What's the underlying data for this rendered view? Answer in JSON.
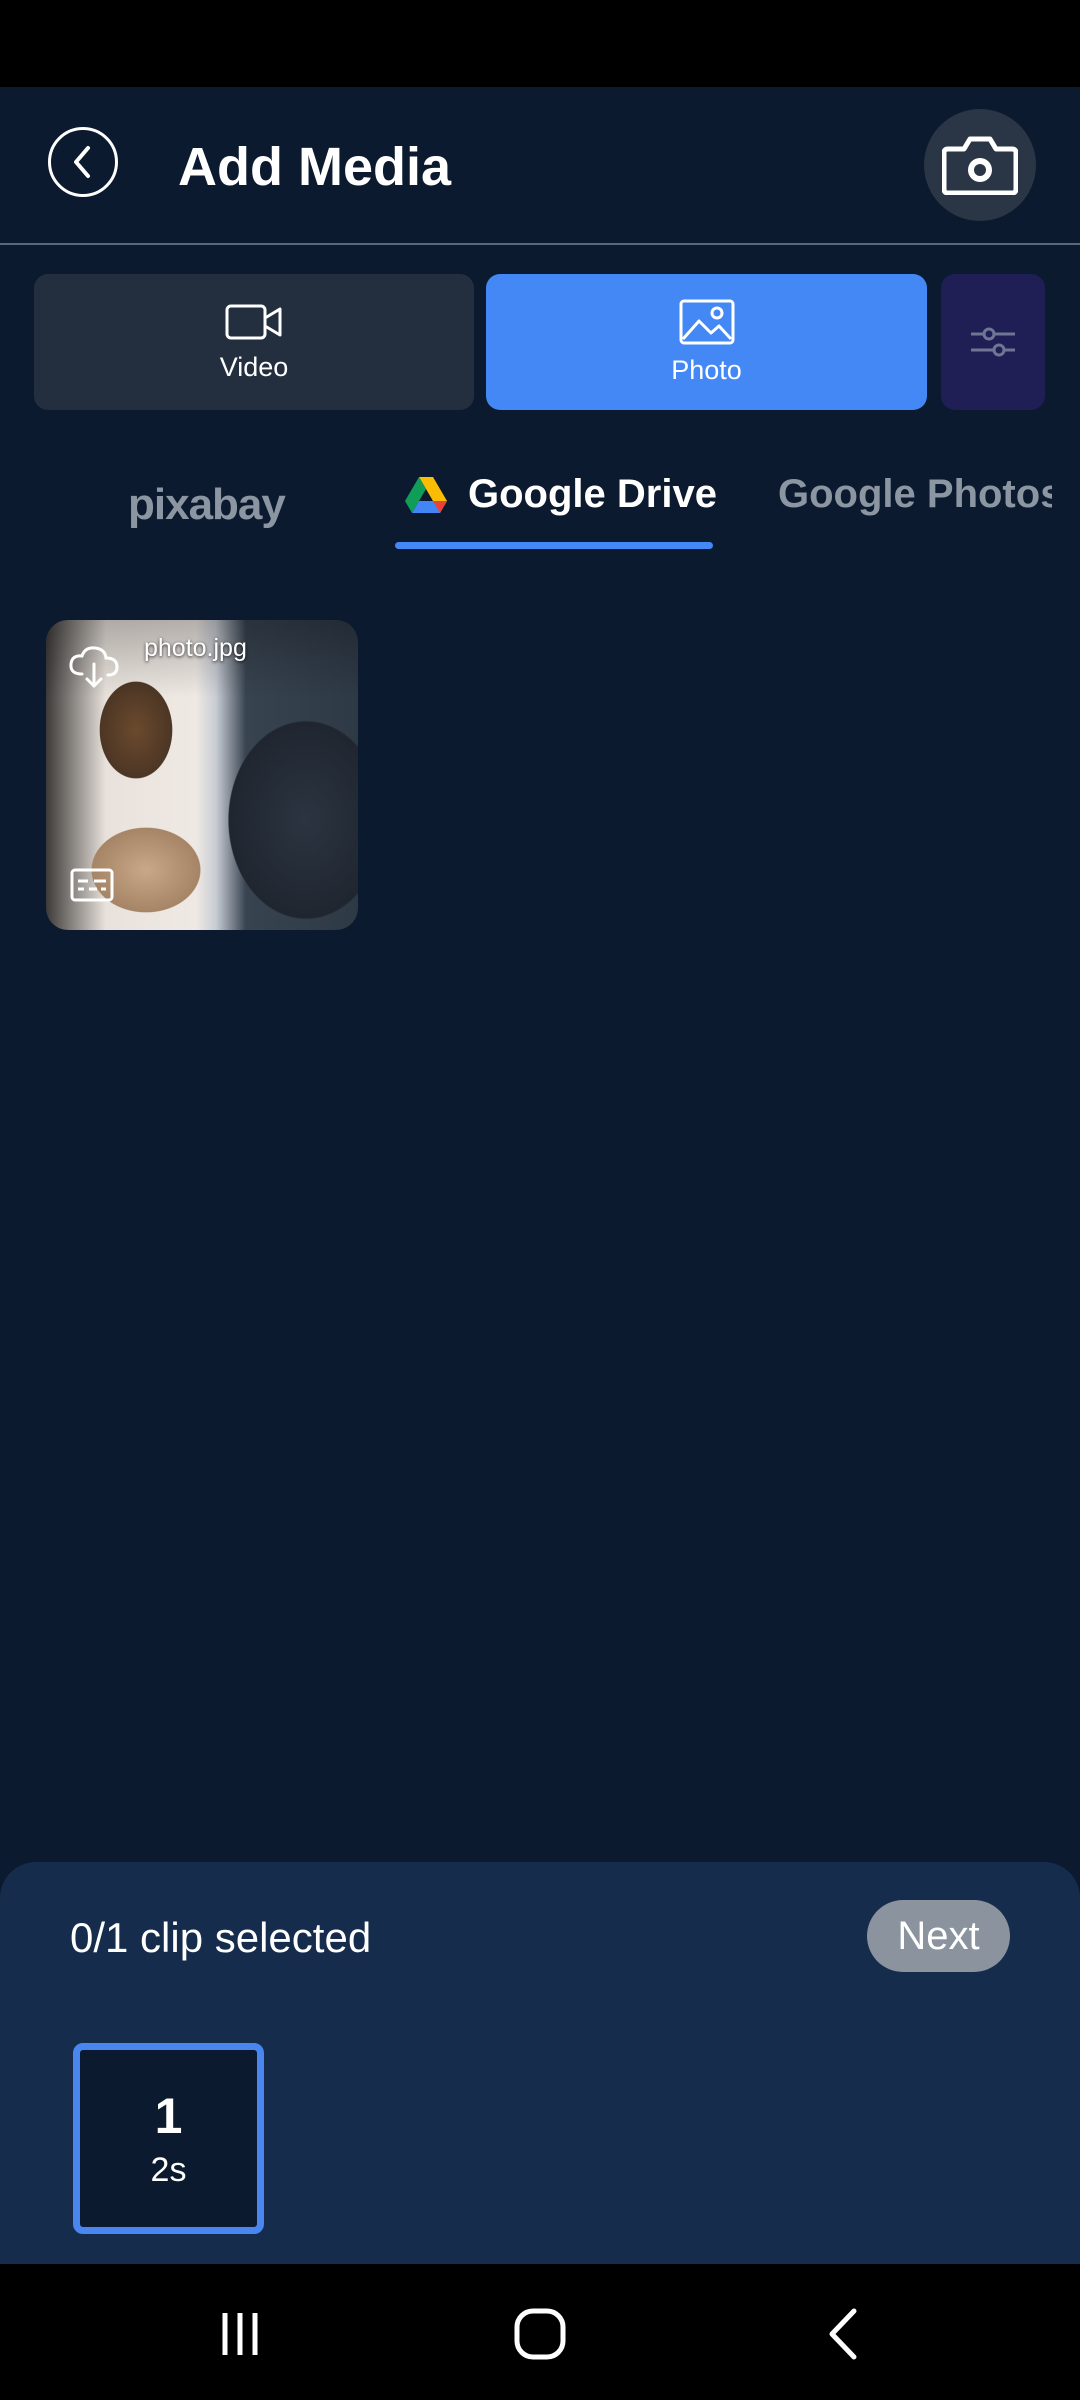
{
  "header": {
    "title": "Add Media"
  },
  "media_toggle": {
    "video_label": "Video",
    "photo_label": "Photo",
    "selected": "Photo"
  },
  "source_tabs": {
    "pixabay": "pixabay",
    "google_drive": "Google Drive",
    "google_photos": "Google Photos",
    "active": "Google Drive"
  },
  "media_items": [
    {
      "name": "photo.jpg"
    }
  ],
  "selection": {
    "status": "0/1 clip selected",
    "next_label": "Next"
  },
  "clip_slots": [
    {
      "number": "1",
      "duration": "2s"
    }
  ],
  "colors": {
    "background": "#0b1a2f",
    "accent": "#4388f5",
    "sheet": "#162c4c"
  },
  "icons": [
    "back-icon",
    "camera-icon",
    "video-icon",
    "photo-icon",
    "filter-icon",
    "google-drive-icon",
    "google-photos-icon",
    "cloud-download-icon",
    "image-type-icon",
    "recents-icon",
    "home-icon",
    "back-nav-icon"
  ]
}
